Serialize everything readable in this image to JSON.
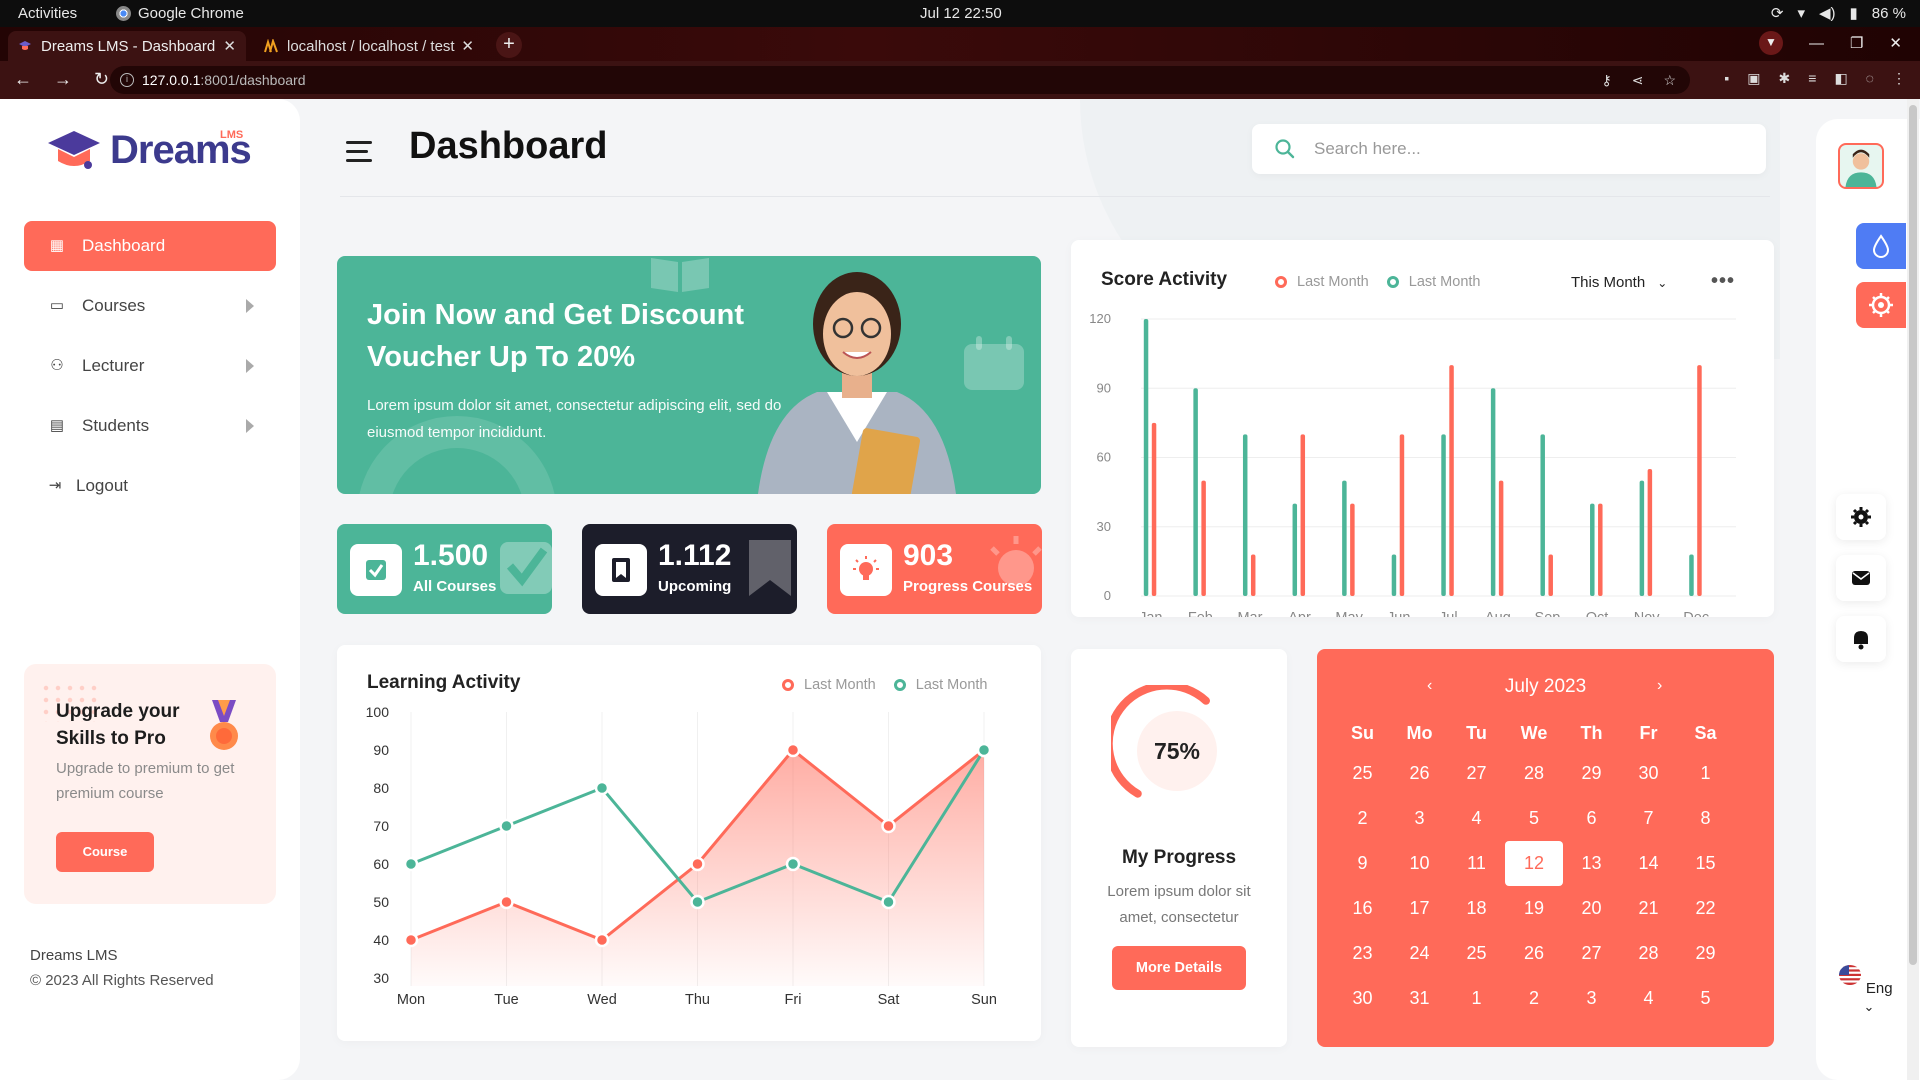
{
  "os": {
    "activities": "Activities",
    "app_name": "Google Chrome",
    "clock": "Jul 12  22:50",
    "battery": "86 %"
  },
  "browser": {
    "tabs": [
      {
        "title": "Dreams LMS - Dashboard"
      },
      {
        "title": "localhost / localhost / test"
      }
    ],
    "url_host": "127.0.0.1",
    "url_path": ":8001/dashboard"
  },
  "brand": {
    "name": "Dreams",
    "badge": "LMS"
  },
  "sidebar": {
    "items": [
      {
        "label": "Dashboard",
        "icon": "grid-icon"
      },
      {
        "label": "Courses",
        "icon": "book-icon"
      },
      {
        "label": "Lecturer",
        "icon": "users-icon"
      },
      {
        "label": "Students",
        "icon": "id-card-icon"
      },
      {
        "label": "Logout",
        "icon": "logout-icon"
      }
    ],
    "upgrade": {
      "title": "Upgrade your Skills to Pro",
      "desc": "Upgrade to premium to get premium course",
      "button": "Course"
    },
    "footer_brand": "Dreams LMS",
    "footer_copy": "© 2023 All Rights Reserved"
  },
  "header": {
    "title": "Dashboard",
    "search_placeholder": "Search here..."
  },
  "promo": {
    "title": "Join Now and Get Discount Voucher Up To 20%",
    "text": "Lorem ipsum dolor sit amet, consectetur adipiscing elit, sed do eiusmod tempor incididunt."
  },
  "stats": [
    {
      "value": "1.500",
      "label": "All Courses",
      "color": "#4cb598"
    },
    {
      "value": "1.112",
      "label": "Upcoming",
      "color": "#1c1d2a"
    },
    {
      "value": "903",
      "label": "Progress Courses",
      "color": "#ff6a59"
    }
  ],
  "score": {
    "title": "Score Activity",
    "legend": [
      "Last Month",
      "Last Month"
    ],
    "period": "This Month"
  },
  "learning": {
    "title": "Learning Activity",
    "legend": [
      "Last Month",
      "Last Month"
    ]
  },
  "progress": {
    "percent": "75%",
    "value": 0.75,
    "title": "My Progress",
    "desc": "Lorem ipsum dolor sit amet, consectetur",
    "button": "More Details"
  },
  "calendar": {
    "month": "July 2023",
    "dow": [
      "Su",
      "Mo",
      "Tu",
      "We",
      "Th",
      "Fr",
      "Sa"
    ],
    "days": [
      "25",
      "26",
      "27",
      "28",
      "29",
      "30",
      "1",
      "2",
      "3",
      "4",
      "5",
      "6",
      "7",
      "8",
      "9",
      "10",
      "11",
      "12",
      "13",
      "14",
      "15",
      "16",
      "17",
      "18",
      "19",
      "20",
      "21",
      "22",
      "23",
      "24",
      "25",
      "26",
      "27",
      "28",
      "29",
      "30",
      "31",
      "1",
      "2",
      "3",
      "4",
      "5"
    ],
    "today": "12"
  },
  "rail": {
    "lang": "Eng"
  },
  "colors": {
    "accent": "#ff6a59",
    "green": "#4cb598",
    "dark": "#1c1d2a",
    "blue": "#4f7cf4"
  },
  "chart_data": [
    {
      "type": "bar",
      "title": "Score Activity",
      "categories": [
        "Jan",
        "Feb",
        "Mar",
        "Apr",
        "May",
        "Jun",
        "Jul",
        "Aug",
        "Sep",
        "Oct",
        "Nov",
        "Dec"
      ],
      "series": [
        {
          "name": "Last Month",
          "color": "#4cb598",
          "values": [
            120,
            90,
            70,
            40,
            50,
            18,
            70,
            90,
            70,
            40,
            50,
            18
          ]
        },
        {
          "name": "Last Month",
          "color": "#ff6a59",
          "values": [
            75,
            50,
            18,
            70,
            40,
            70,
            100,
            50,
            18,
            40,
            55,
            100
          ]
        }
      ],
      "yticks": [
        0,
        30,
        60,
        90,
        120
      ],
      "ylim": [
        0,
        120
      ],
      "grid": true
    },
    {
      "type": "line",
      "title": "Learning Activity",
      "categories": [
        "Mon",
        "Tue",
        "Wed",
        "Thu",
        "Fri",
        "Sat",
        "Sun"
      ],
      "series": [
        {
          "name": "Last Month",
          "color": "#ff6a59",
          "values": [
            40,
            50,
            40,
            60,
            90,
            70,
            90
          ],
          "fill": true
        },
        {
          "name": "Last Month",
          "color": "#4cb598",
          "values": [
            60,
            70,
            80,
            50,
            60,
            50,
            90
          ]
        }
      ],
      "yticks": [
        30,
        40,
        50,
        60,
        70,
        80,
        90,
        100
      ],
      "ylim": [
        30,
        100
      ],
      "grid": true
    }
  ]
}
